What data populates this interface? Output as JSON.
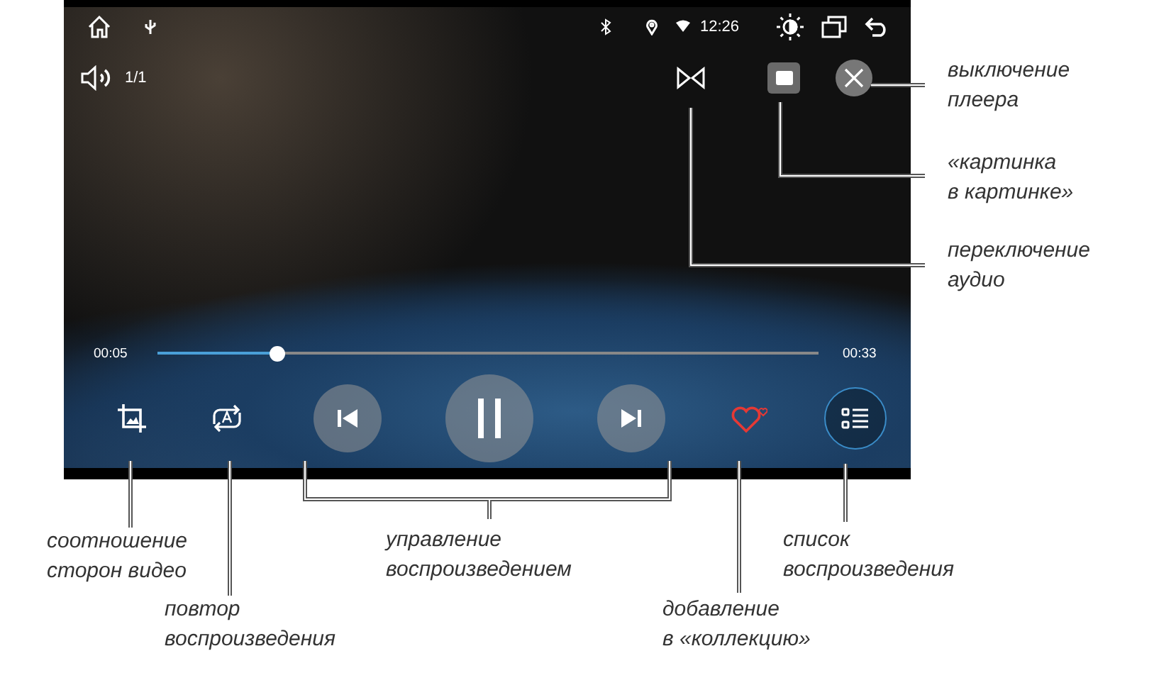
{
  "status_bar": {
    "time": "12:26"
  },
  "player": {
    "track_counter": "1/1",
    "playing": true,
    "favorite": false,
    "seek": {
      "elapsed": "00:05",
      "total": "00:33",
      "level": 0.18
    }
  },
  "callouts": [
    {
      "text": "выключение\nплеера"
    },
    {
      "text": "«картинка\nв картинке»"
    },
    {
      "text": "переключение\nаудио"
    },
    {
      "text": "соотношение\nсторон видео"
    },
    {
      "text": "повтор\nвоспроизведения"
    },
    {
      "text": "управление\nвоспроизведением"
    },
    {
      "text": "добавление\nв «коллекцию»"
    },
    {
      "text": "список\nвоспроизведения"
    }
  ]
}
